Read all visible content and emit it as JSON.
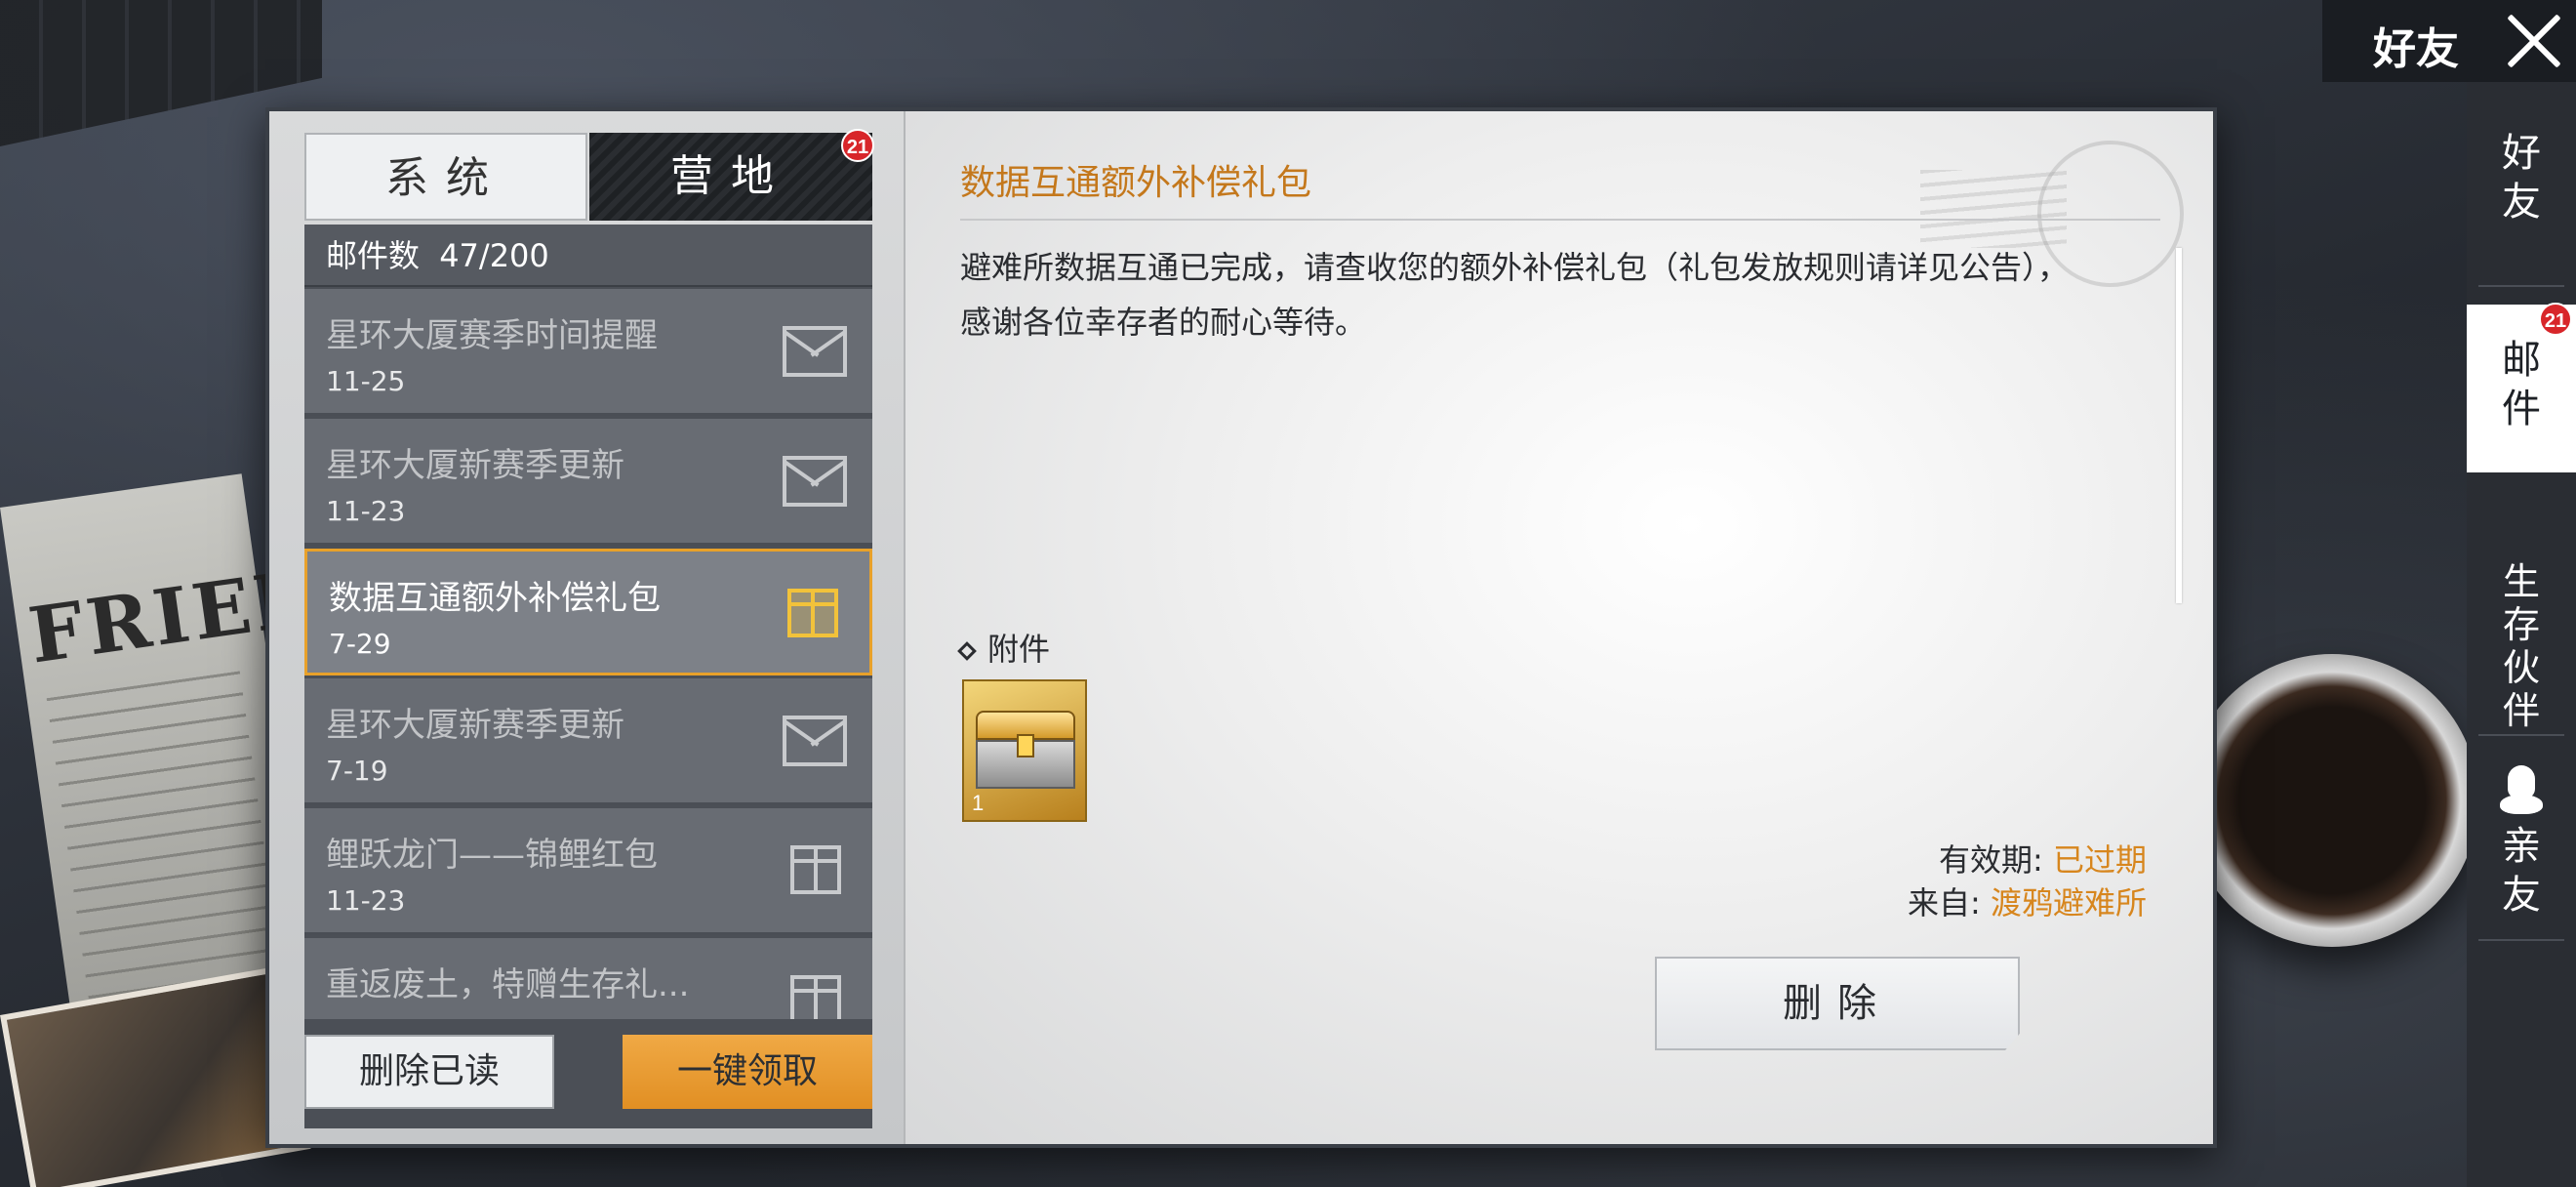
{
  "header": {
    "title": "好友"
  },
  "side_tabs": [
    {
      "label": "好友",
      "active": false
    },
    {
      "label": "邮件",
      "active": true,
      "badge": "21"
    },
    {
      "label": "生存伙伴",
      "active": false
    },
    {
      "label": "亲友",
      "active": false,
      "icon": "qq-icon"
    }
  ],
  "mail_tabs": {
    "system": "系统",
    "camp": "营地",
    "camp_badge": "21"
  },
  "mail_count": {
    "label": "邮件数",
    "value": "47/200"
  },
  "mail_list": [
    {
      "subject": "星环大厦赛季时间提醒",
      "date": "11-25",
      "icon": "envelope-icon",
      "active": false
    },
    {
      "subject": "星环大厦新赛季更新",
      "date": "11-23",
      "icon": "envelope-icon",
      "active": false
    },
    {
      "subject": "数据互通额外补偿礼包",
      "date": "7-29",
      "icon": "gift-icon",
      "active": true
    },
    {
      "subject": "星环大厦新赛季更新",
      "date": "7-19",
      "icon": "envelope-icon",
      "active": false
    },
    {
      "subject": "鲤跃龙门——锦鲤红包",
      "date": "11-23",
      "icon": "gift-icon",
      "active": false
    },
    {
      "subject": "重返废土，特赠生存礼...",
      "date": "",
      "icon": "gift-icon",
      "active": false
    }
  ],
  "buttons": {
    "delete_read": "删除已读",
    "claim_all": "一键领取",
    "delete": "删除"
  },
  "detail": {
    "title": "数据互通额外补偿礼包",
    "body": "避难所数据互通已完成，请查收您的额外补偿礼包（礼包发放规则请详见公告），感谢各位幸存者的耐心等待。",
    "attachments_label": "附件",
    "attachments": [
      {
        "icon": "treasure-chest-icon",
        "count": "1"
      }
    ],
    "expire_label": "有效期:",
    "expire_value": "已过期",
    "from_label": "来自:",
    "from_value": "渡鸦避难所"
  },
  "colors": {
    "accent_gold": "#e8a12a",
    "highlight_text": "#d7861e",
    "title_orange": "#c4781c",
    "badge_red": "#d8262a"
  }
}
